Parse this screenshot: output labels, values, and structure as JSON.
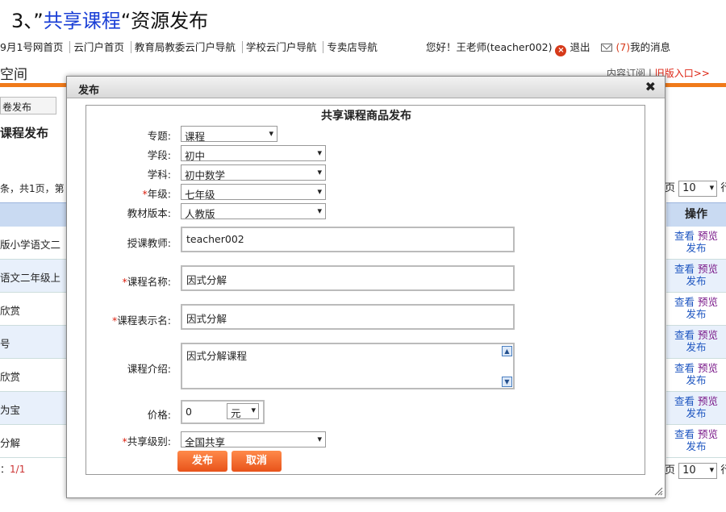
{
  "heading": {
    "prefix": "3、”",
    "highlight": "共享课程",
    "suffix": "“资源发布"
  },
  "topnav": {
    "items": [
      "9月1号网首页",
      "云门户首页",
      "教育局教委云门户导航",
      "学校云门户导航",
      "专卖店导航"
    ],
    "greeting": "您好！王老师(teacher002)",
    "logout": "退出",
    "msg_count": "(7)",
    "msg_label": "我的消息"
  },
  "space_title": "空间",
  "topright": {
    "prefix": "内容订阅 | ",
    "link": "旧版入口>>"
  },
  "bg": {
    "tab": "卷发布",
    "subtitle": "课程发布",
    "pager_left": "条，共1页，第",
    "page_label": "页",
    "page_size": "10",
    "rows_label": "行",
    "op_header": "操作",
    "rows": [
      "版小学语文二",
      "语文二年级上",
      "欣赏",
      "号",
      "欣赏",
      "为宝",
      "分解"
    ],
    "view": "查看",
    "preview": "预览",
    "publish": "发布",
    "bottom_prefix": "：",
    "bottom_page": "1/1"
  },
  "dialog": {
    "title": "发布",
    "close": "✖",
    "form_title": "共享课程商品发布",
    "fields": {
      "topic": {
        "label": "专题:",
        "value": "课程"
      },
      "stage": {
        "label": "学段:",
        "value": "初中"
      },
      "subject": {
        "label": "学科:",
        "value": "初中数学"
      },
      "grade": {
        "label": "年级:",
        "value": "七年级"
      },
      "edition": {
        "label": "教材版本:",
        "value": "人教版"
      },
      "teacher": {
        "label": "授课教师:",
        "value": "teacher002"
      },
      "course_name": {
        "label": "课程名称:",
        "value": "因式分解"
      },
      "display_name": {
        "label": "课程表示名:",
        "value": "因式分解"
      },
      "intro": {
        "label": "课程介绍:",
        "value": "因式分解课程"
      },
      "price": {
        "label": "价格:",
        "value": "0",
        "unit": "元"
      },
      "share_level": {
        "label": "共享级别:",
        "value": "全国共享"
      }
    },
    "publish_btn": "发布",
    "cancel_btn": "取消"
  }
}
